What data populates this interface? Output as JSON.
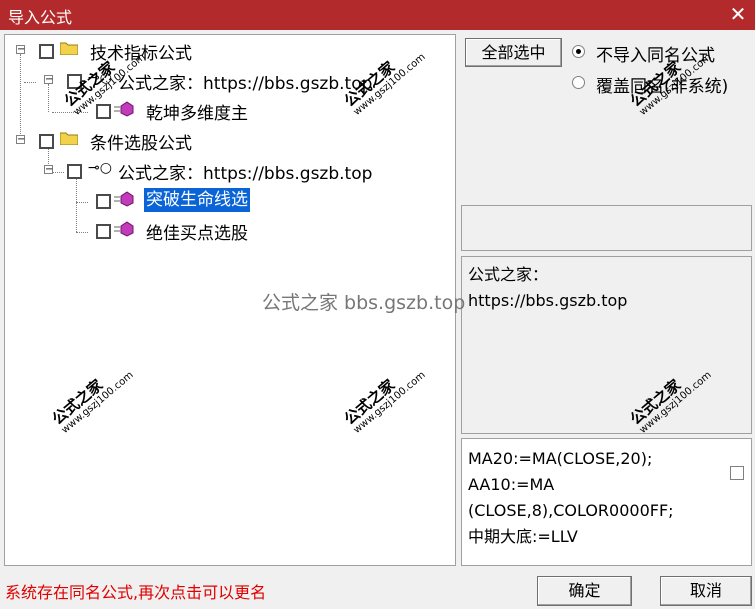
{
  "window": {
    "title": "导入公式",
    "close_glyph": "✕"
  },
  "tree": {
    "group1": {
      "label": "技术指标公式",
      "child": {
        "label": "公式之家：https://bbs.gszb.top",
        "leaf": {
          "label": "乾坤多维度主"
        }
      }
    },
    "group2": {
      "label": "条件选股公式",
      "child": {
        "label": "公式之家：https://bbs.gszb.top",
        "leaves": [
          {
            "label": "突破生命线选"
          },
          {
            "label": "绝佳买点选股"
          }
        ]
      }
    }
  },
  "controls": {
    "select_all_label": "全部选中",
    "radio_no_import_label": "不导入同名公式",
    "radio_overwrite_label": "覆盖同名(非系统)"
  },
  "info": {
    "line1": "公式之家：",
    "line2": "https://bbs.gszb.top"
  },
  "code": {
    "lines": [
      "MA20:=MA(CLOSE,20);",
      "AA10:=MA",
      "(CLOSE,8),COLOR0000FF;",
      "中期大底:=LLV"
    ]
  },
  "status_message": "系统存在同名公式,再次点击可以更名",
  "buttons": {
    "ok_label": "确定",
    "cancel_label": "取消"
  },
  "watermark": {
    "mark": "公式之家",
    "site": "www.gszj100.com",
    "center_text": "公式之家 bbs.gszb.top"
  },
  "icons": [
    "folder-icon",
    "key-icon",
    "formula-icon",
    "checkbox-icon"
  ]
}
